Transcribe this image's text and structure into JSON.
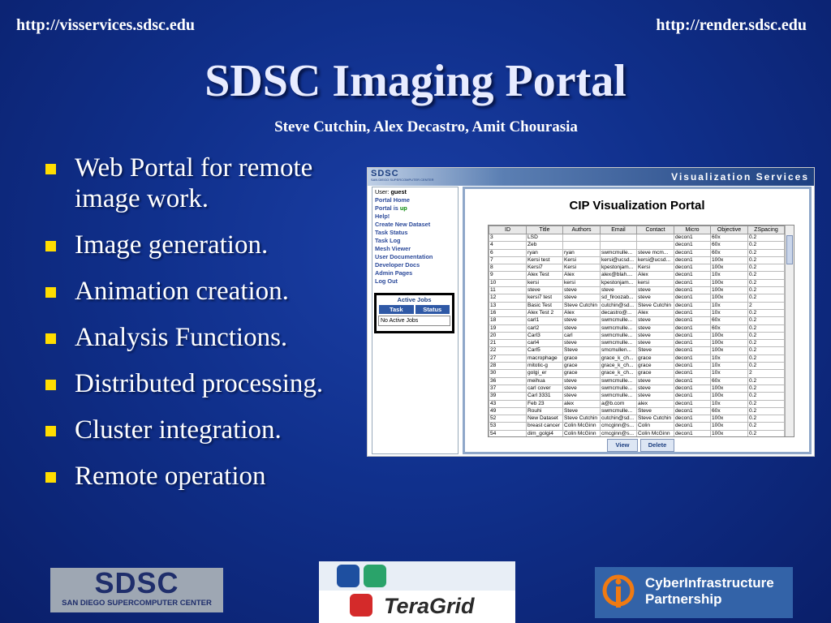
{
  "header": {
    "url_left": "http://visservices.sdsc.edu",
    "url_right": "http://render.sdsc.edu",
    "title": "SDSC Imaging Portal",
    "authors": "Steve Cutchin, Alex Decastro, Amit Chourasia"
  },
  "bullets": [
    "Web Portal for remote image work.",
    "Image generation.",
    "Animation creation.",
    "Analysis Functions.",
    "Distributed processing.",
    "Cluster integration.",
    "Remote operation"
  ],
  "colors": {
    "bullet": "#ffdd00",
    "background": "#10308c"
  },
  "portal": {
    "logo": "SDSC",
    "logo_sub": "SAN DIEGO SUPERCOMPUTER CENTER",
    "banner": "Visualization Services",
    "user_label": "User:",
    "user_name": "guest",
    "nav": [
      "Portal Home",
      "Portal is",
      "Help!",
      "Create New Dataset",
      "Task Status",
      "Task Log",
      "Mesh Viewer",
      "User Documentation",
      "Developer Docs",
      "Admin Pages",
      "Log Out"
    ],
    "portal_status": "up",
    "active_jobs": {
      "title": "Active Jobs",
      "col_task": "Task",
      "col_status": "Status",
      "empty": "No Active Jobs"
    },
    "main_title": "CIP Visualization Portal",
    "columns": [
      "ID",
      "Title",
      "Authors",
      "Email",
      "Contact",
      "Micro",
      "Objective",
      "ZSpacing"
    ],
    "rows": [
      [
        "3",
        "LSD",
        "",
        "",
        "",
        "decon1",
        "60x",
        "0.2"
      ],
      [
        "4",
        "Zeb",
        "",
        "",
        "",
        "decon1",
        "60x",
        "0.2"
      ],
      [
        "6",
        "ryan",
        "ryan",
        "swmcmulle...",
        "steve mcm...",
        "decon1",
        "60x",
        "0.2"
      ],
      [
        "7",
        "Kersi test",
        "Kersi",
        "kersi@ucsd...",
        "kersi@ucsd...",
        "decon1",
        "100x",
        "0.2"
      ],
      [
        "8",
        "Kersi7",
        "Kersi",
        "kpestonjam...",
        "Kersi",
        "decon1",
        "100x",
        "0.2"
      ],
      [
        "9",
        "Alex Test",
        "Alex",
        "alex@blah....",
        "Alex",
        "decon1",
        "10x",
        "0.2"
      ],
      [
        "10",
        "kersi",
        "kersi",
        "kpestonjam...",
        "kersi",
        "decon1",
        "100x",
        "0.2"
      ],
      [
        "11",
        "steve",
        "steve",
        "steve",
        "steve",
        "decon1",
        "100x",
        "0.2"
      ],
      [
        "12",
        "kersi7 test",
        "steve",
        "sd_firoozab...",
        "steve",
        "decon1",
        "100x",
        "0.2"
      ],
      [
        "13",
        "Basic Test",
        "Steve Cutchin",
        "cutchin@sd...",
        "Steve Cutchin",
        "decon1",
        "10x",
        "2"
      ],
      [
        "16",
        "Alex Test 2",
        "Alex",
        "decastro@...",
        "Alex",
        "decon1",
        "10x",
        "0.2"
      ],
      [
        "18",
        "carl1",
        "steve",
        "swmcmulle...",
        "steve",
        "decon1",
        "60x",
        "0.2"
      ],
      [
        "19",
        "carl2",
        "steve",
        "swmcmulle...",
        "steve",
        "decon1",
        "60x",
        "0.2"
      ],
      [
        "20",
        "Carl3",
        "carl",
        "swmcmulle...",
        "steve",
        "decon1",
        "100x",
        "0.2"
      ],
      [
        "21",
        "carl4",
        "steve",
        "swmcmulle...",
        "steve",
        "decon1",
        "100x",
        "0.2"
      ],
      [
        "22",
        "Carl5",
        "Steve",
        "smcmullen...",
        "Steve",
        "decon1",
        "100x",
        "0.2"
      ],
      [
        "27",
        "macrophage",
        "grace",
        "grace_k_ch...",
        "grace",
        "decon1",
        "10x",
        "0.2"
      ],
      [
        "28",
        "mitotic-g",
        "grace",
        "grace_k_ch...",
        "grace",
        "decon1",
        "10x",
        "0.2"
      ],
      [
        "30",
        "golgi_er",
        "grace",
        "grace_k_ch...",
        "grace",
        "decon1",
        "10x",
        "2"
      ],
      [
        "36",
        "meihua",
        "steve",
        "swmcmulle...",
        "steve",
        "decon1",
        "60x",
        "0.2"
      ],
      [
        "37",
        "carl cover",
        "steve",
        "swmcmulle...",
        "steve",
        "decon1",
        "100x",
        "0.2"
      ],
      [
        "39",
        "Carl 3331",
        "steve",
        "swmcmulle...",
        "steve",
        "decon1",
        "100x",
        "0.2"
      ],
      [
        "43",
        "Feb 23",
        "alex",
        "a@b.com",
        "alex",
        "decon1",
        "10x",
        "0.2"
      ],
      [
        "49",
        "Rouhi",
        "Steve",
        "swmcmulle...",
        "Steve",
        "decon1",
        "60x",
        "0.2"
      ],
      [
        "52",
        "New Dataset",
        "Steve Cutchin",
        "cutchin@sd...",
        "Steve Cutchin",
        "decon1",
        "100x",
        "0.2"
      ],
      [
        "53",
        "breast cancer",
        "Colin McGinn",
        "cmcginn@s...",
        "Colin",
        "decon1",
        "100x",
        "0.2"
      ],
      [
        "54",
        "dim_golgi4",
        "Colin McGinn",
        "cmcginn@s...",
        "Colin McGinn",
        "decon1",
        "100x",
        "0.2"
      ]
    ],
    "btn_view": "View",
    "btn_delete": "Delete"
  },
  "logos": {
    "sdsc_main": "SDSC",
    "sdsc_sub": "SAN DIEGO SUPERCOMPUTER CENTER",
    "teragrid": "TeraGrid",
    "ci_line1": "CyberInfrastructure",
    "ci_line2": "Partnership"
  }
}
